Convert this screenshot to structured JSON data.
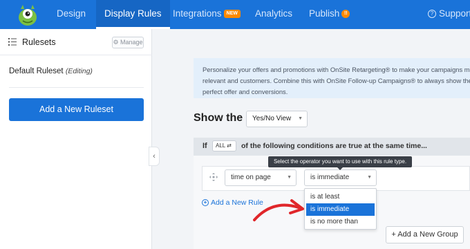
{
  "nav": {
    "items": [
      {
        "label": "Design"
      },
      {
        "label": "Display Rules"
      },
      {
        "label": "Integrations",
        "badge": "NEW"
      },
      {
        "label": "Analytics"
      },
      {
        "label": "Publish",
        "badge": "!!"
      }
    ],
    "support": "Support"
  },
  "sidebar": {
    "title": "Rulesets",
    "manage": "Manage",
    "ruleset": "Default Ruleset",
    "ruleset_state": "(Editing)",
    "add_button": "Add a New Ruleset",
    "collapse_glyph": "‹"
  },
  "info": {
    "text": "Personalize your offers and promotions with OnSite Retargeting® to make your campaigns more relevant and customers. Combine this with OnSite Follow-up Campaigns® to always show the perfect offer and conversions."
  },
  "show": {
    "label": "Show the",
    "view_value": "Yes/No View"
  },
  "condition": {
    "if": "If",
    "all": "ALL",
    "text": "of the following conditions are true at the same time..."
  },
  "rule": {
    "field_value": "time on page",
    "operator_value": "is immediate",
    "tooltip": "Select the operator you want to use with this rule type.",
    "options": [
      "is at least",
      "is immediate",
      "is no more than"
    ],
    "selected_index": 1
  },
  "actions": {
    "add_rule": "Add a New Rule",
    "add_group": "+ Add a New Group"
  },
  "colors": {
    "primary": "#1a73d9",
    "badge": "#ff8a00",
    "annotation": "#e0262a"
  }
}
